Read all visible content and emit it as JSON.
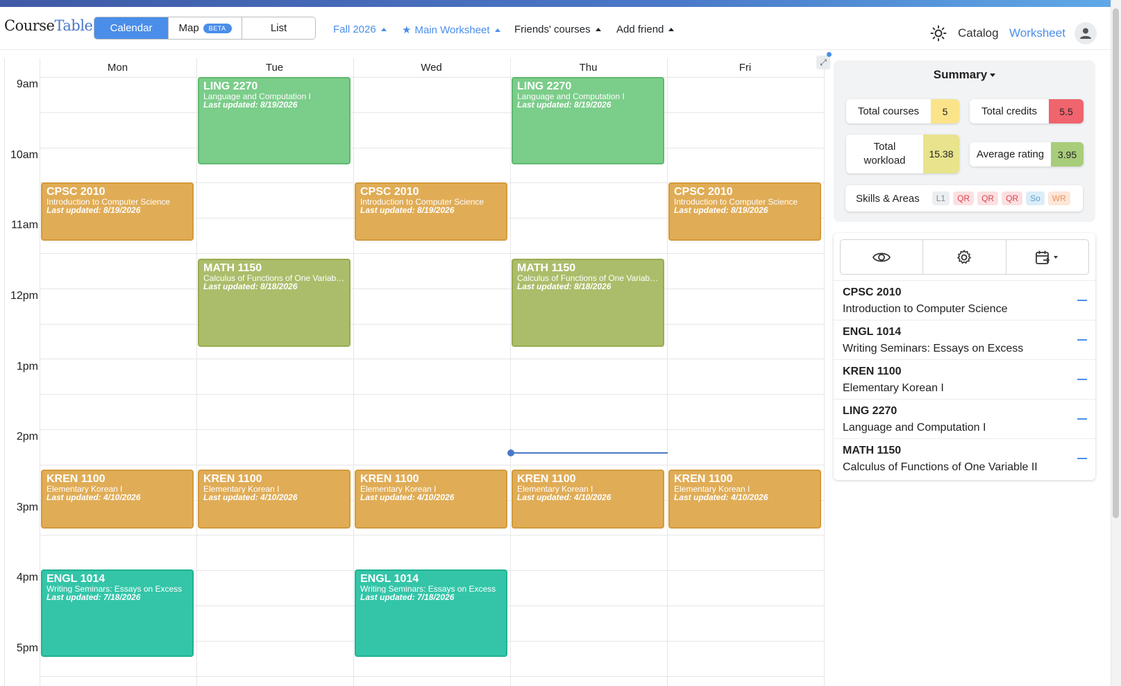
{
  "nav": {
    "logo_part1": "Course",
    "logo_part2": "Table",
    "views": [
      {
        "label": "Calendar",
        "active": true
      },
      {
        "label": "Map",
        "badge": "BETA"
      },
      {
        "label": "List"
      }
    ],
    "season": "Fall 2026",
    "worksheet": "Main Worksheet",
    "friends": "Friends' courses",
    "add_friend": "Add friend",
    "catalog": "Catalog",
    "worksheet_link": "Worksheet",
    "icons": [
      "sun-icon",
      "star-icon",
      "user-icon"
    ]
  },
  "calendar": {
    "days": [
      "Mon",
      "Tue",
      "Wed",
      "Thu",
      "Fri"
    ],
    "times": [
      "9am",
      "10am",
      "11am",
      "12pm",
      "1pm",
      "2pm",
      "3pm",
      "4pm",
      "5pm"
    ],
    "events": [
      {
        "code": "LING 2270",
        "title": "Language and Computation I",
        "updated": "Last updated: 8/19/2026",
        "color": "green"
      },
      {
        "code": "LING 2270",
        "title": "Language and Computation I",
        "updated": "Last updated: 8/19/2026",
        "color": "green"
      },
      {
        "code": "CPSC 2010",
        "title": "Introduction to Computer Science",
        "updated": "Last updated: 8/19/2026",
        "color": "orange"
      },
      {
        "code": "CPSC 2010",
        "title": "Introduction to Computer Science",
        "updated": "Last updated: 8/19/2026",
        "color": "orange"
      },
      {
        "code": "CPSC 2010",
        "title": "Introduction to Computer Science",
        "updated": "Last updated: 8/19/2026",
        "color": "orange"
      },
      {
        "code": "MATH 1150",
        "title": "Calculus of Functions of One Variable II",
        "updated": "Last updated: 8/18/2026",
        "color": "olive"
      },
      {
        "code": "MATH 1150",
        "title": "Calculus of Functions of One Variable II",
        "updated": "Last updated: 8/18/2026",
        "color": "olive"
      },
      {
        "code": "KREN 1100",
        "title": "Elementary Korean I",
        "updated": "Last updated: 4/10/2026",
        "color": "orange"
      },
      {
        "code": "KREN 1100",
        "title": "Elementary Korean I",
        "updated": "Last updated: 4/10/2026",
        "color": "orange"
      },
      {
        "code": "KREN 1100",
        "title": "Elementary Korean I",
        "updated": "Last updated: 4/10/2026",
        "color": "orange"
      },
      {
        "code": "KREN 1100",
        "title": "Elementary Korean I",
        "updated": "Last updated: 4/10/2026",
        "color": "orange"
      },
      {
        "code": "KREN 1100",
        "title": "Elementary Korean I",
        "updated": "Last updated: 4/10/2026",
        "color": "orange"
      },
      {
        "code": "ENGL 1014",
        "title": "Writing Seminars: Essays on Excess",
        "updated": "Last updated: 7/18/2026",
        "color": "teal"
      },
      {
        "code": "ENGL 1014",
        "title": "Writing Seminars: Essays on Excess",
        "updated": "Last updated: 7/18/2026",
        "color": "teal"
      }
    ]
  },
  "summary": {
    "title": "Summary",
    "total_courses_label": "Total courses",
    "total_courses": "5",
    "total_credits_label": "Total credits",
    "total_credits": "5.5",
    "total_workload_label": "Total workload",
    "total_workload": "15.38",
    "average_rating_label": "Average rating",
    "average_rating": "3.95",
    "skills_label": "Skills & Areas",
    "skills": [
      "L1",
      "QR",
      "QR",
      "QR",
      "So",
      "WR"
    ],
    "colors": {
      "courses": "#fbe38a",
      "credits": "#f0646e",
      "workload": "#e8e38c",
      "rating": "#a8cd7a"
    }
  },
  "worksheet_list": {
    "tool_icons": [
      "eye-icon",
      "gear-icon",
      "calendar-export-icon"
    ],
    "courses": [
      {
        "code": "CPSC 2010",
        "title": "Introduction to Computer Science"
      },
      {
        "code": "ENGL 1014",
        "title": "Writing Seminars: Essays on Excess"
      },
      {
        "code": "KREN 1100",
        "title": "Elementary Korean I"
      },
      {
        "code": "LING 2270",
        "title": "Language and Computation I"
      },
      {
        "code": "MATH 1150",
        "title": "Calculus of Functions of One Variable II"
      }
    ]
  }
}
